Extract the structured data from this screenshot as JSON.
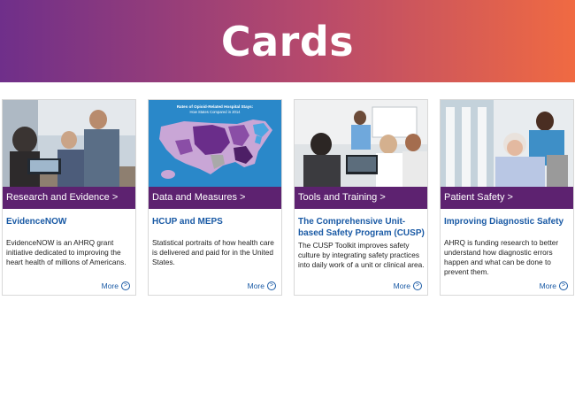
{
  "banner": {
    "title": "Cards"
  },
  "cards": [
    {
      "category": "Research and Evidence >",
      "title": "EvidenceNOW",
      "description": "EvidenceNOW is an AHRQ grant initiative dedicated to improving the heart health of millions of Americans.",
      "more": "More"
    },
    {
      "category": "Data and Measures >",
      "title": "HCUP and MEPS",
      "description": "Statistical portraits of how health care is delivered and paid for in the United States.",
      "more": "More",
      "map_title": "Rates of Opioid-Related Hospital Stays:",
      "map_subtitle": "How States Compared in 2014"
    },
    {
      "category": "Tools and Training >",
      "title": "The Comprehensive Unit-based Safety Program (CUSP)",
      "description": "The CUSP Toolkit improves safety culture by integrating safety practices into daily work of a unit or clinical area.",
      "more": "More"
    },
    {
      "category": "Patient Safety >",
      "title": "Improving Diagnostic Safety",
      "description": "AHRQ is funding research to better understand how diagnostic errors happen and what can be done to prevent them.",
      "more": "More"
    }
  ],
  "icons": {
    "more": "chevron-right-circle-icon"
  },
  "colors": {
    "category_bar": "#5d2270",
    "link": "#1a5aa5",
    "gradient_start": "#6f2f8a",
    "gradient_end": "#f06a42"
  }
}
